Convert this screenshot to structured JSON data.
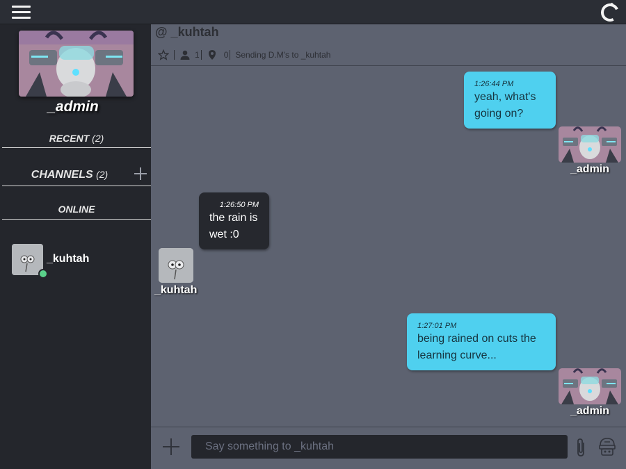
{
  "topbar": {
    "menu_icon": "hamburger-icon",
    "status_icon": "loading-ring-icon"
  },
  "sidebar": {
    "username": "_admin",
    "sections": [
      {
        "label": "RECENT",
        "count": "(2)"
      },
      {
        "label": "CHANNELS",
        "count": "(2)"
      },
      {
        "label": "ONLINE"
      }
    ],
    "online_users": [
      {
        "name": "_kuhtah",
        "status_color": "#5ad08a"
      }
    ]
  },
  "header": {
    "title": "@ _kuhtah",
    "members": "1",
    "locations": "0",
    "description": "Sending D.M's to _kuhtah"
  },
  "messages": [
    {
      "from": "_admin",
      "time": "1:26:44 PM",
      "text_lines": [
        "yeah, what's",
        "going on?"
      ]
    },
    {
      "from": "_kuhtah",
      "time": "1:26:50 PM",
      "text_lines": [
        "the rain is",
        "wet :0"
      ]
    },
    {
      "from": "_admin",
      "time": "1:27:01 PM",
      "text_lines": [
        "being rained on cuts the",
        "learning curve..."
      ]
    }
  ],
  "composer": {
    "placeholder": "Say something to _kuhtah"
  },
  "colors": {
    "accent": "#4fd0ef",
    "online": "#5ad08a",
    "sidebar": "#24262c",
    "main": "#5d6270"
  }
}
